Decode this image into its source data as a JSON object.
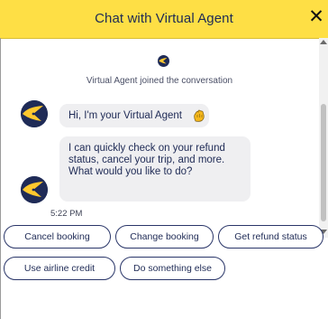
{
  "header": {
    "title": "Chat with Virtual Agent",
    "close_label": "✕"
  },
  "system": {
    "joined_text": "Virtual Agent joined the conversation"
  },
  "messages": [
    {
      "text": "Hi, I'm your Virtual Agent",
      "emoji": "waving-hand"
    },
    {
      "text": "I can quickly check on your refund status, cancel your trip, and more. What would you like to do?"
    }
  ],
  "timestamp": "5:22 PM",
  "quick_replies": [
    "Cancel booking",
    "Change booking",
    "Get refund status",
    "Use airline credit",
    "Do something else"
  ],
  "colors": {
    "header_bg": "#fedf45",
    "navy": "#1f2b57",
    "bubble_bg": "#efeff1",
    "logo_yellow": "#ffc82e"
  }
}
